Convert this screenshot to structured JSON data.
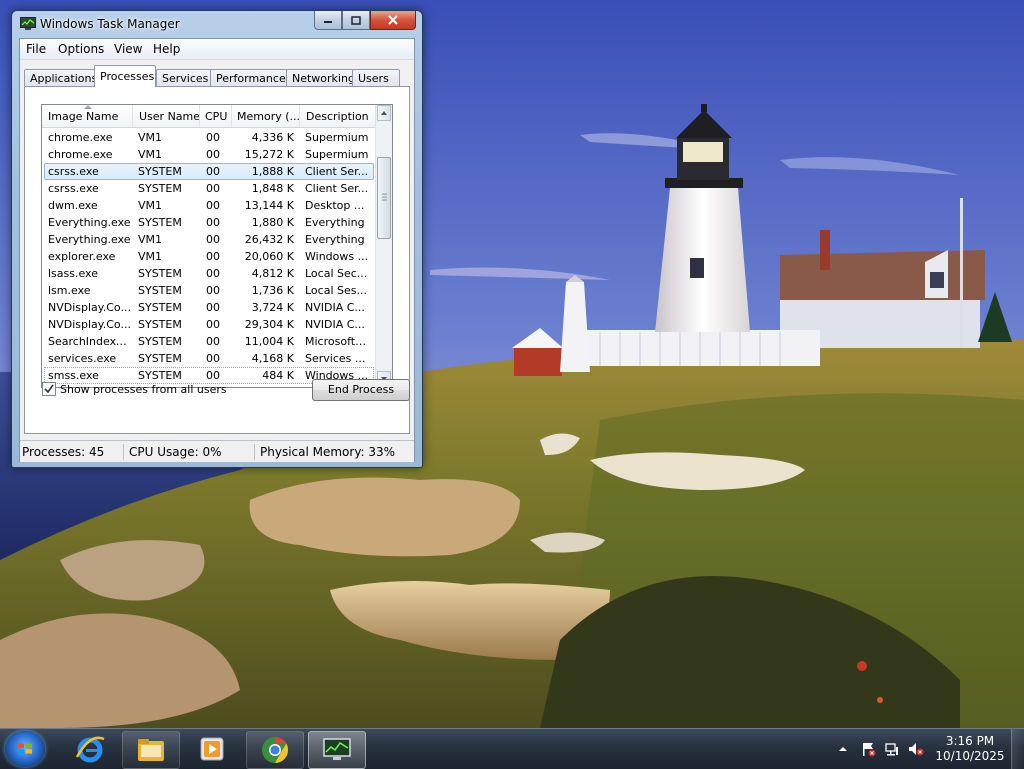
{
  "window": {
    "title": "Windows Task Manager",
    "menu": [
      "File",
      "Options",
      "View",
      "Help"
    ],
    "tabs": [
      "Applications",
      "Processes",
      "Services",
      "Performance",
      "Networking",
      "Users"
    ],
    "selected_tab": "Processes"
  },
  "processes": {
    "columns": [
      "Image Name",
      "User Name",
      "CPU",
      "Memory (...",
      "Description"
    ],
    "rows": [
      {
        "name": "chrome.exe",
        "user": "VM1",
        "cpu": "00",
        "mem": "4,336 K",
        "desc": "Supermium"
      },
      {
        "name": "chrome.exe",
        "user": "VM1",
        "cpu": "00",
        "mem": "15,272 K",
        "desc": "Supermium"
      },
      {
        "name": "csrss.exe",
        "user": "SYSTEM",
        "cpu": "00",
        "mem": "1,888 K",
        "desc": "Client Ser..."
      },
      {
        "name": "csrss.exe",
        "user": "SYSTEM",
        "cpu": "00",
        "mem": "1,848 K",
        "desc": "Client Ser..."
      },
      {
        "name": "dwm.exe",
        "user": "VM1",
        "cpu": "00",
        "mem": "13,144 K",
        "desc": "Desktop ..."
      },
      {
        "name": "Everything.exe",
        "user": "SYSTEM",
        "cpu": "00",
        "mem": "1,880 K",
        "desc": "Everything"
      },
      {
        "name": "Everything.exe",
        "user": "VM1",
        "cpu": "00",
        "mem": "26,432 K",
        "desc": "Everything"
      },
      {
        "name": "explorer.exe",
        "user": "VM1",
        "cpu": "00",
        "mem": "20,060 K",
        "desc": "Windows ..."
      },
      {
        "name": "lsass.exe",
        "user": "SYSTEM",
        "cpu": "00",
        "mem": "4,812 K",
        "desc": "Local Sec..."
      },
      {
        "name": "lsm.exe",
        "user": "SYSTEM",
        "cpu": "00",
        "mem": "1,736 K",
        "desc": "Local Ses..."
      },
      {
        "name": "NVDisplay.Co...",
        "user": "SYSTEM",
        "cpu": "00",
        "mem": "3,724 K",
        "desc": "NVIDIA C..."
      },
      {
        "name": "NVDisplay.Co...",
        "user": "SYSTEM",
        "cpu": "00",
        "mem": "29,304 K",
        "desc": "NVIDIA C..."
      },
      {
        "name": "SearchIndexe...",
        "user": "SYSTEM",
        "cpu": "00",
        "mem": "11,004 K",
        "desc": "Microsoft ..."
      },
      {
        "name": "services.exe",
        "user": "SYSTEM",
        "cpu": "00",
        "mem": "4,168 K",
        "desc": "Services ..."
      },
      {
        "name": "smss.exe",
        "user": "SYSTEM",
        "cpu": "00",
        "mem": "484 K",
        "desc": "Windows ..."
      }
    ],
    "selected_row": 2,
    "show_all_label": "Show processes from all users",
    "show_all_checked": true,
    "end_process_label": "End Process"
  },
  "status": {
    "processes": "Processes: 45",
    "cpu": "CPU Usage: 0%",
    "memory": "Physical Memory: 33%"
  },
  "taskbar": {
    "start_icon": "windows-orb-icon",
    "pinned": [
      "internet-explorer-icon",
      "file-explorer-icon",
      "media-player-icon",
      "chrome-icon",
      "task-manager-icon"
    ],
    "tray_icons": [
      "show-hidden-icons-icon",
      "action-center-icon",
      "network-icon",
      "volume-muted-icon"
    ],
    "time": "3:16 PM",
    "date": "10/10/2025"
  }
}
